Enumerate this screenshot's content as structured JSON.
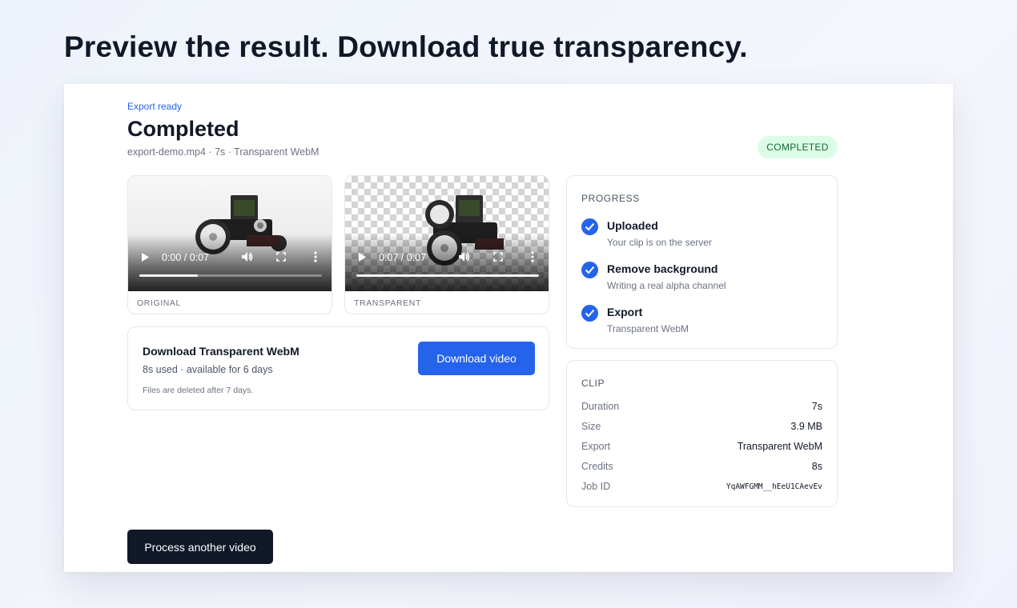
{
  "headline": "Preview the result. Download true transparency.",
  "job": {
    "eyebrow": "Export ready",
    "title": "Completed",
    "subtitle": "export-demo.mp4 · 7s · Transparent WebM",
    "status": "COMPLETED"
  },
  "videos": [
    {
      "label": "ORIGINAL",
      "time": "0:00 / 0:07",
      "progress": 0.32
    },
    {
      "label": "TRANSPARENT",
      "time": "0:07 / 0:07",
      "progress": 1.0
    }
  ],
  "download": {
    "title": "Download Transparent WebM",
    "meta": "8s used · available for 6 days",
    "note": "Files are deleted after 7 days.",
    "button": "Download video"
  },
  "progress": {
    "title": "PROGRESS",
    "steps": [
      {
        "title": "Uploaded",
        "desc": "Your clip is on the server"
      },
      {
        "title": "Remove background",
        "desc": "Writing a real alpha channel"
      },
      {
        "title": "Export",
        "desc": "Transparent WebM"
      }
    ]
  },
  "clip": {
    "title": "CLIP",
    "rows": [
      {
        "key": "Duration",
        "value": "7s"
      },
      {
        "key": "Size",
        "value": "3.9 MB"
      },
      {
        "key": "Export",
        "value": "Transparent WebM"
      },
      {
        "key": "Credits",
        "value": "8s"
      },
      {
        "key": "Job ID",
        "value": "YqAWFGMM__hEeU1CAevEv"
      }
    ]
  },
  "actions": {
    "process_another": "Process another video"
  },
  "colors": {
    "accent": "#2563eb",
    "success_bg": "#dcfce7",
    "success_text": "#166534",
    "dark_button": "#111827"
  },
  "icons": {
    "play": "play-icon",
    "volume": "volume-icon",
    "fullscreen": "fullscreen-icon",
    "more": "more-vertical-icon",
    "check": "check-icon"
  }
}
